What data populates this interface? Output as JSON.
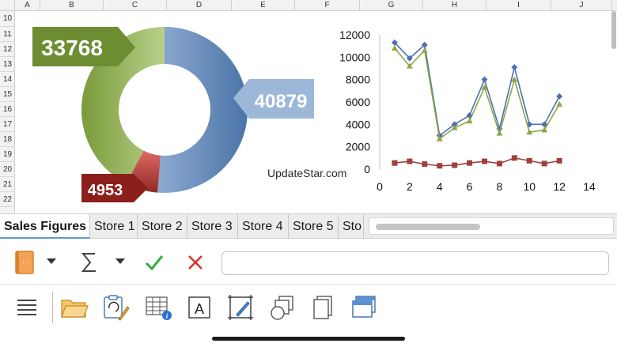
{
  "sheet": {
    "columns": [
      "A",
      "B",
      "C",
      "D",
      "E",
      "F",
      "G",
      "H",
      "I",
      "J"
    ],
    "rows": [
      "10",
      "11",
      "12",
      "13",
      "14",
      "15",
      "16",
      "17",
      "18",
      "19",
      "20",
      "21",
      "22"
    ]
  },
  "donut": {
    "values": [
      33768,
      40879,
      4953
    ],
    "labels": [
      "33768",
      "40879",
      "4953"
    ],
    "colors": [
      "#9bbb59",
      "#4f81bd",
      "#c0504d"
    ]
  },
  "watermark": "UpdateStar.com",
  "chart_data": {
    "type": "line",
    "x": [
      1,
      2,
      3,
      4,
      5,
      6,
      7,
      8,
      9,
      10,
      11,
      12
    ],
    "series": [
      {
        "values": [
          11300,
          9900,
          11100,
          3000,
          4000,
          4800,
          8000,
          3600,
          9100,
          4000,
          4000,
          6500
        ],
        "color": "#4f6fb0",
        "marker": "diamond"
      },
      {
        "values": [
          10800,
          9200,
          10600,
          2700,
          3700,
          4300,
          7300,
          3200,
          8000,
          3300,
          3500,
          5800
        ],
        "color": "#8ea64a",
        "marker": "triangle"
      },
      {
        "values": [
          550,
          700,
          450,
          300,
          350,
          550,
          700,
          500,
          1000,
          750,
          500,
          750
        ],
        "color": "#a0403c",
        "marker": "square"
      }
    ],
    "xlim": [
      0,
      14
    ],
    "ylim": [
      0,
      12000
    ],
    "xticks": [
      "0",
      "2",
      "4",
      "6",
      "8",
      "10",
      "12",
      "14"
    ],
    "yticks": [
      "0",
      "2000",
      "4000",
      "6000",
      "8000",
      "10000",
      "12000"
    ],
    "grid": false
  },
  "tabs": [
    "Sales Figures",
    "Store 1",
    "Store 2",
    "Store 3",
    "Store 4",
    "Store 5",
    "Sto"
  ],
  "formula": {
    "value": "",
    "icons": [
      "function-book-icon",
      "sum-icon",
      "accept-icon",
      "cancel-icon"
    ]
  },
  "toolbar": {
    "icons": [
      "menu-icon",
      "open-folder-icon",
      "paste-format-icon",
      "table-info-icon",
      "text-box-icon",
      "crop-image-icon",
      "shapes-icon",
      "pages-icon",
      "windows-icon"
    ]
  }
}
